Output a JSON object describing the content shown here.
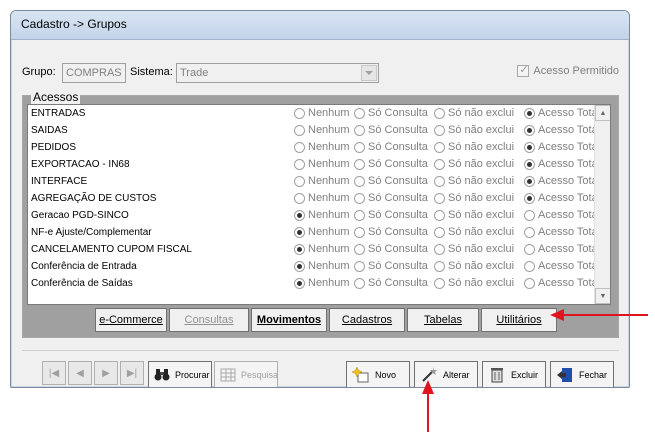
{
  "window": {
    "title": "Cadastro -> Grupos"
  },
  "form": {
    "grupo_label": "Grupo:",
    "grupo_value": "COMPRAS",
    "sistema_label": "Sistema:",
    "sistema_value": "Trade",
    "acesso_permitido_label": "Acesso Permitido"
  },
  "group": {
    "title": "Acessos"
  },
  "options": [
    "Nenhum",
    "Só Consulta",
    "Só não exclui",
    "Acesso Total"
  ],
  "rows": [
    {
      "name": "ENTRADAS",
      "selected": 3
    },
    {
      "name": "SAIDAS",
      "selected": 3
    },
    {
      "name": "PEDIDOS",
      "selected": 3
    },
    {
      "name": "EXPORTACAO - IN68",
      "selected": 3
    },
    {
      "name": "INTERFACE",
      "selected": 3
    },
    {
      "name": " AGREGAÇÃO DE CUSTOS",
      "selected": 3
    },
    {
      "name": "Geracao PGD-SINCO",
      "selected": 0
    },
    {
      "name": "NF-e Ajuste/Complementar",
      "selected": 0
    },
    {
      "name": "CANCELAMENTO CUPOM FISCAL",
      "selected": 0
    },
    {
      "name": "Conferência de Entrada",
      "selected": 0
    },
    {
      "name": "Conferência de Saídas",
      "selected": 0
    }
  ],
  "tabs": [
    {
      "label": "e-Commerce",
      "state": "normal"
    },
    {
      "label": "Consultas",
      "state": "disabled"
    },
    {
      "label": "Movimentos",
      "state": "active"
    },
    {
      "label": "Cadastros",
      "state": "normal"
    },
    {
      "label": "Tabelas",
      "state": "normal"
    },
    {
      "label": "Utilitários",
      "state": "normal"
    }
  ],
  "toolbar": {
    "procurar": "Procurar",
    "pesquisa": "Pesquisa",
    "novo": "Novo",
    "alterar": "Alterar",
    "excluir": "Excluir",
    "fechar": "Fechar"
  },
  "colors": {
    "annotation_arrow": "#e0141e"
  }
}
